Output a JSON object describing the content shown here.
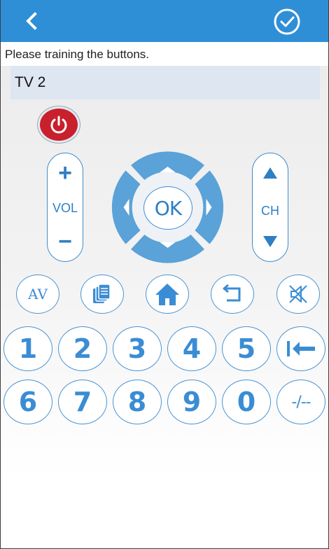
{
  "header": {
    "back_icon": "chevron-left-icon",
    "confirm_icon": "check-circle-icon"
  },
  "instruction": "Please training the buttons.",
  "device_name": "TV 2",
  "remote": {
    "power_icon": "power-icon",
    "volume_label": "VOL",
    "volume_up": "+",
    "volume_down": "−",
    "channel_label": "CH",
    "ok_label": "OK",
    "av_label": "AV",
    "menu_icon": "copy-pages-icon",
    "home_icon": "home-icon",
    "return_icon": "return-icon",
    "mute_icon": "mute-icon",
    "digits_row1": [
      "1",
      "2",
      "3",
      "4",
      "5"
    ],
    "back_digit_icon": "back-to-start-icon",
    "digits_row2": [
      "6",
      "7",
      "8",
      "9",
      "0"
    ],
    "dash_label": "-/--"
  },
  "colors": {
    "header": "#2f8fd6",
    "accent": "#3a8dd4",
    "power": "#c8202c",
    "device_bar": "#dde6f1"
  }
}
